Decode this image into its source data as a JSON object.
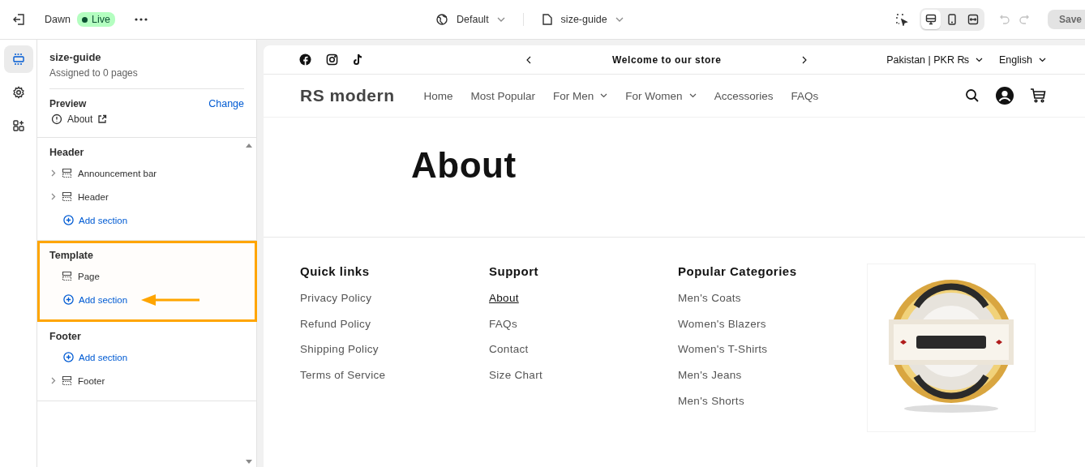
{
  "topbar": {
    "theme": "Dawn",
    "status": "Live",
    "template_selector": "Default",
    "page_selector": "size-guide",
    "view_modes": [
      {
        "kind": "desktop",
        "selected": true
      },
      {
        "kind": "mobile",
        "selected": false
      },
      {
        "kind": "fullwidth",
        "selected": false
      }
    ],
    "save": {
      "label": "Save",
      "disabled": true
    }
  },
  "rail": [
    {
      "kind": "sections",
      "selected": true
    },
    {
      "kind": "settings",
      "selected": false
    },
    {
      "kind": "apps",
      "selected": false
    }
  ],
  "panel": {
    "title": "size-guide",
    "subtitle": "Assigned to 0 pages",
    "preview_label": "Preview",
    "change_link": "Change",
    "preview_page": "About"
  },
  "groups": [
    {
      "title": "Header",
      "highlighted": false,
      "items": [
        {
          "kind": "section",
          "label": "Announcement bar",
          "expandable": true
        },
        {
          "kind": "section",
          "label": "Header",
          "expandable": true
        },
        {
          "kind": "add",
          "label": "Add section",
          "expandable": false
        }
      ]
    },
    {
      "title": "Template",
      "highlighted": true,
      "items": [
        {
          "kind": "section",
          "label": "Page",
          "expandable": false
        },
        {
          "kind": "add",
          "label": "Add section",
          "expandable": false
        }
      ]
    },
    {
      "title": "Footer",
      "highlighted": false,
      "items": [
        {
          "kind": "add",
          "label": "Add section",
          "expandable": false
        },
        {
          "kind": "section",
          "label": "Footer",
          "expandable": true
        }
      ]
    }
  ],
  "preview": {
    "announcement": "Welcome to our store",
    "country": "Pakistan | PKR ₨",
    "language": "English",
    "logo": "RS modern",
    "nav": [
      {
        "label": "Home",
        "dropdown": false
      },
      {
        "label": "Most Popular",
        "dropdown": false
      },
      {
        "label": "For Men",
        "dropdown": true
      },
      {
        "label": "For Women",
        "dropdown": true
      },
      {
        "label": "Accessories",
        "dropdown": false
      },
      {
        "label": "FAQs",
        "dropdown": false
      }
    ],
    "page_title": "About",
    "footer_columns": [
      {
        "heading": "Quick links",
        "links": [
          {
            "label": "Privacy Policy",
            "current": false
          },
          {
            "label": "Refund Policy",
            "current": false
          },
          {
            "label": "Shipping Policy",
            "current": false
          },
          {
            "label": "Terms of Service",
            "current": false
          }
        ]
      },
      {
        "heading": "Support",
        "links": [
          {
            "label": "About",
            "current": true
          },
          {
            "label": "FAQs",
            "current": false
          },
          {
            "label": "Contact",
            "current": false
          },
          {
            "label": "Size Chart",
            "current": false
          }
        ]
      },
      {
        "heading": "Popular Categories",
        "links": [
          {
            "label": "Men's Coats",
            "current": false
          },
          {
            "label": "Women's Blazers",
            "current": false
          },
          {
            "label": "Women's T-Shirts",
            "current": false
          },
          {
            "label": "Men's Jeans",
            "current": false
          },
          {
            "label": "Men's Shorts",
            "current": false
          }
        ]
      }
    ]
  }
}
